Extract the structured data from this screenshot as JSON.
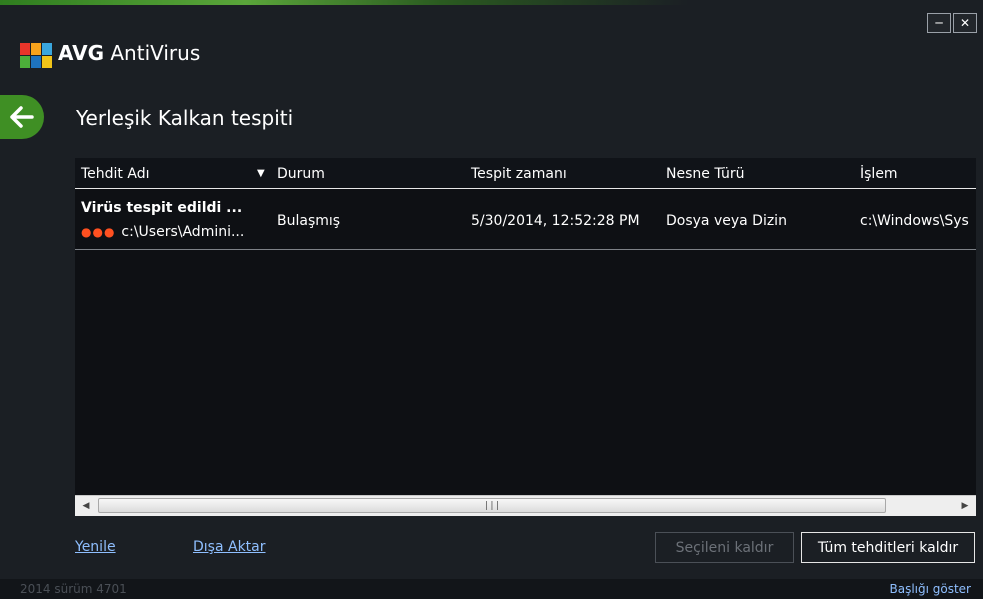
{
  "app": {
    "brand": "AVG",
    "product": "AntiVirus",
    "colors": {
      "accent_green": "#3f8f24",
      "link_blue": "#8fbfff",
      "dot_red": "#ff5020"
    }
  },
  "window_controls": {
    "minimize_icon": "minimize-icon",
    "close_icon": "close-icon"
  },
  "page": {
    "title": "Yerleşik Kalkan tespiti"
  },
  "table": {
    "columns": [
      "Tehdit Adı",
      "Durum",
      "Tespit zamanı",
      "Nesne Türü",
      "İşlem"
    ],
    "sorted_column": "Tehdit Adı",
    "rows": [
      {
        "threat_name": "Virüs tespit edildi ...",
        "threat_path": "c:\\Users\\Admini...",
        "status": "Bulaşmış",
        "detected_at": "5/30/2014, 12:52:28 PM",
        "object_type": "Dosya veya Dizin",
        "process": "c:\\Windows\\Sys"
      }
    ]
  },
  "footer": {
    "refresh_link": "Yenile",
    "export_link": "Dışa Aktar",
    "remove_selected": "Seçileni kaldır",
    "remove_all": "Tüm tehditleri kaldır"
  },
  "statusbar": {
    "version": "2014  sürüm 4701",
    "show_header": "Başlığı göster"
  }
}
